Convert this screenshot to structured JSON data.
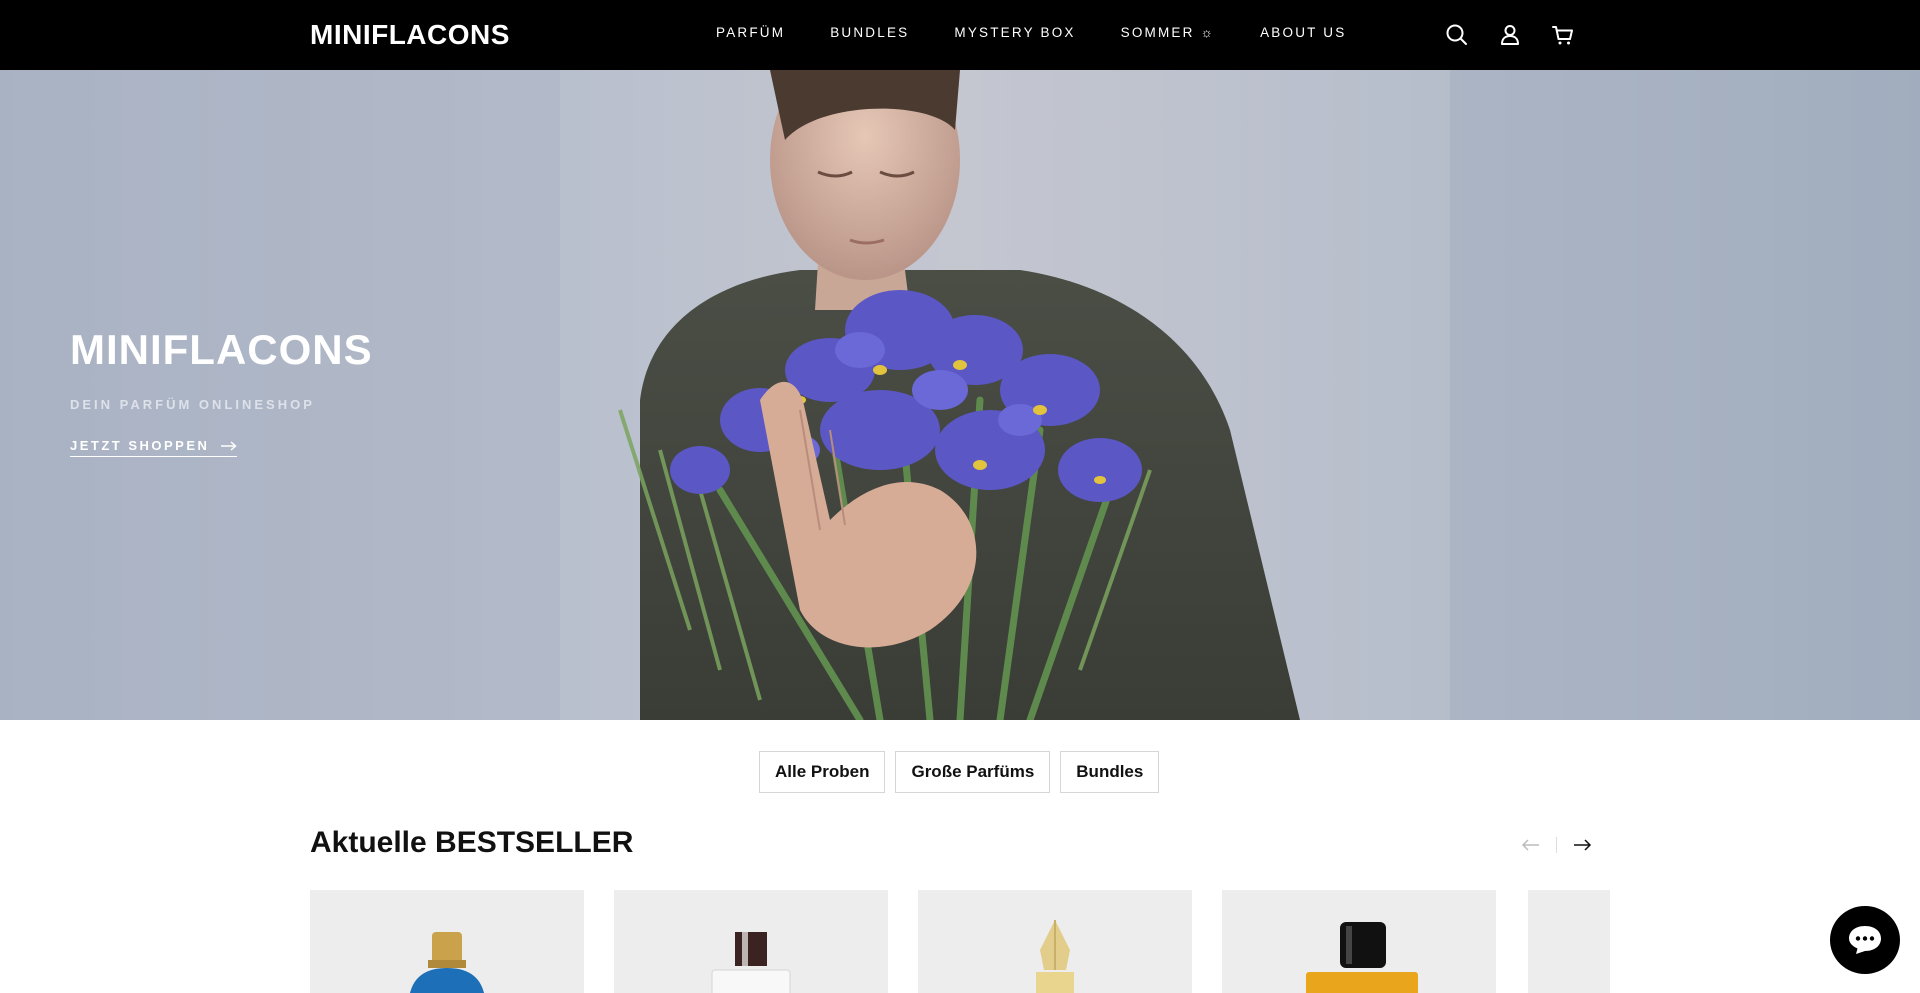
{
  "header": {
    "logo": "MINIFLACONS",
    "nav": [
      "PARFÜM",
      "BUNDLES",
      "MYSTERY BOX",
      "SOMMER ☼",
      "ABOUT US"
    ],
    "icons": [
      "search-icon",
      "account-icon",
      "cart-icon"
    ]
  },
  "hero": {
    "title": "MINIFLACONS",
    "subtitle": "DEIN PARFÜM ONLINESHOP",
    "cta": "JETZT SHOPPEN"
  },
  "pills": [
    "Alle Proben",
    "Große Parfüms",
    "Bundles"
  ],
  "bestseller": {
    "title": "Aktuelle BESTSELLER",
    "prev_icon": "arrow-left-icon",
    "next_icon": "arrow-right-icon"
  },
  "colors": {
    "header_bg": "#000000",
    "accent": "#000000",
    "card_bg": "#ededed"
  },
  "chat": {
    "icon": "chat-bubble-icon"
  }
}
